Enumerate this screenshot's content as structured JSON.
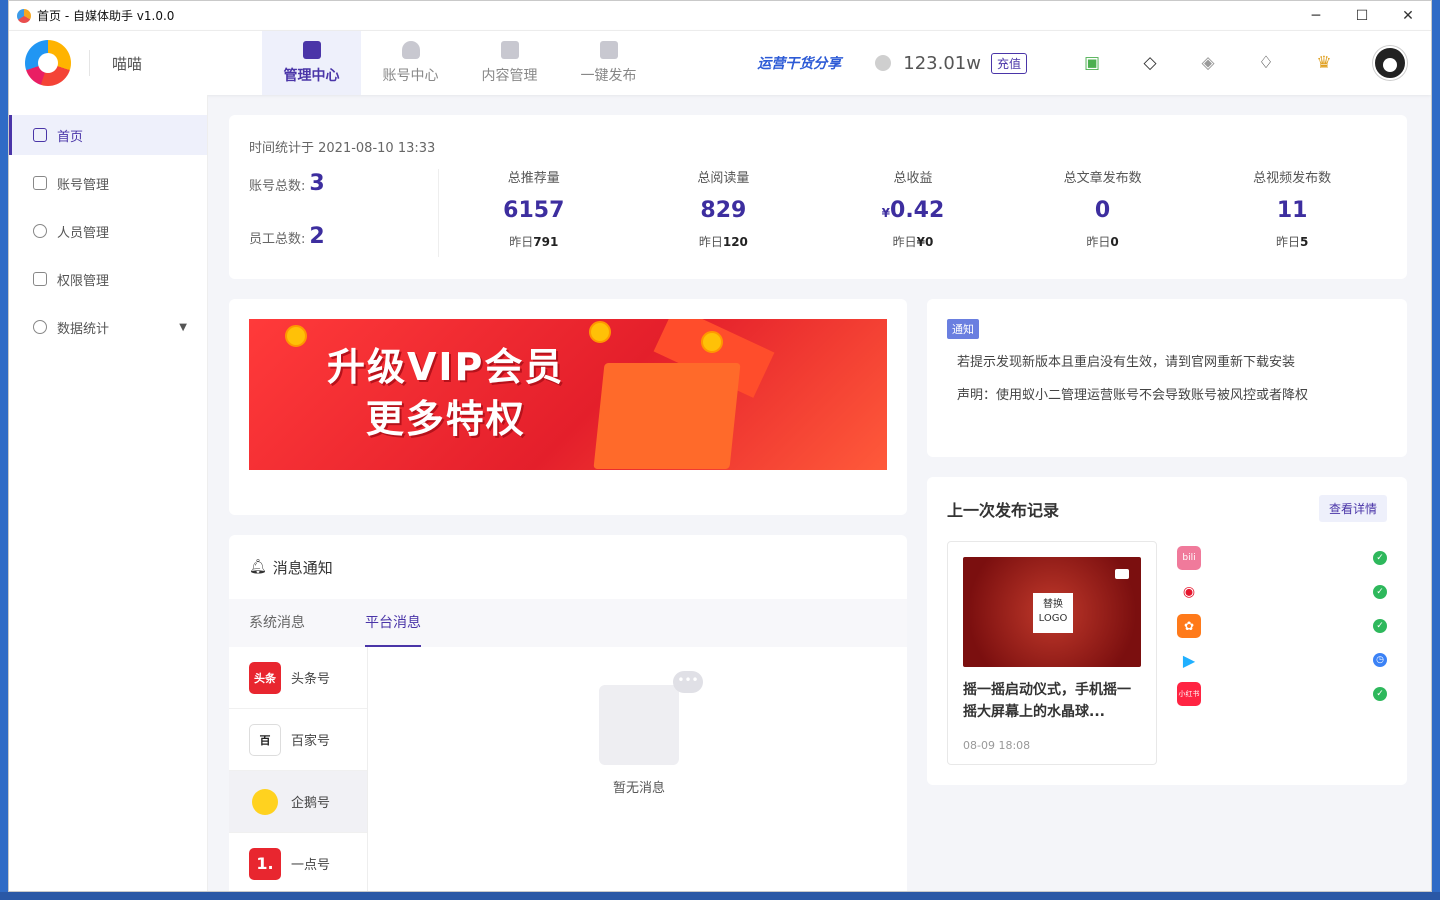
{
  "window": {
    "title": "首页 - 自媒体助手 v1.0.0",
    "minimize": "─",
    "maximize": "☐",
    "close": "✕"
  },
  "header": {
    "user_name": "喵喵",
    "nav": [
      {
        "label": "管理中心",
        "icon": "monitor-icon"
      },
      {
        "label": "账号中心",
        "icon": "user-icon"
      },
      {
        "label": "内容管理",
        "icon": "document-icon"
      },
      {
        "label": "一键发布",
        "icon": "video-icon"
      }
    ],
    "promo": "运营干货分享",
    "balance": "123.01w",
    "recharge": "充值"
  },
  "sidebar": {
    "items": [
      {
        "label": "首页",
        "icon": "home-icon"
      },
      {
        "label": "账号管理",
        "icon": "grid-icon"
      },
      {
        "label": "人员管理",
        "icon": "person-icon"
      },
      {
        "label": "权限管理",
        "icon": "lock-icon"
      },
      {
        "label": "数据统计",
        "icon": "chart-icon"
      }
    ]
  },
  "stats": {
    "time": "时间统计于 2021-08-10 13:33",
    "accounts_label": "账号总数:",
    "accounts": "3",
    "staff_label": "员工总数:",
    "staff": "2",
    "columns": [
      {
        "label": "总推荐量",
        "value": "6157",
        "yday_label": "昨日",
        "yday": "791"
      },
      {
        "label": "总阅读量",
        "value": "829",
        "yday_label": "昨日",
        "yday": "120"
      },
      {
        "label": "总收益",
        "prefix": "¥",
        "value": "0.42",
        "yday_label": "昨日",
        "yday": "¥0"
      },
      {
        "label": "总文章发布数",
        "value": "0",
        "yday_label": "昨日",
        "yday": "0"
      },
      {
        "label": "总视频发布数",
        "value": "11",
        "yday_label": "昨日",
        "yday": "5"
      }
    ]
  },
  "banner": {
    "line1": "升级VIP会员",
    "line2": "更多特权"
  },
  "notice": {
    "tag": "通知",
    "lines": [
      "若提示发现新版本且重启没有生效，请到官网重新下载安装",
      "声明：使用蚁小二管理运营账号不会导致账号被风控或者降权"
    ]
  },
  "publish": {
    "title": "上一次发布记录",
    "more": "查看详情",
    "item_text": "摇一摇启动仪式，手机摇一摇大屏幕上的水晶球...",
    "item_date": "08-09 18:08",
    "thumb_logo": "替换 LOGO",
    "platforms": [
      {
        "name": "bilibili",
        "color": "#f07a9b",
        "status": "done"
      },
      {
        "name": "weibo",
        "color": "#ffffff",
        "status": "done"
      },
      {
        "name": "kuaishou",
        "color": "#ff7a1a",
        "status": "done"
      },
      {
        "name": "tencent-video",
        "color": "#ffffff",
        "status": "pending"
      },
      {
        "name": "xiaohongshu",
        "color": "#ff2442",
        "status": "done"
      }
    ]
  },
  "messages": {
    "title": "消息通知",
    "tabs": [
      "系统消息",
      "平台消息"
    ],
    "platforms": [
      {
        "label": "头条号",
        "badge": "头条",
        "color": "#e8262f"
      },
      {
        "label": "百家号",
        "badge": "百",
        "color": "#ffffff"
      },
      {
        "label": "企鹅号",
        "badge": "",
        "color": "#ffffff"
      },
      {
        "label": "一点号",
        "badge": "1.",
        "color": "#e8262f"
      }
    ],
    "empty": "暂无消息"
  }
}
